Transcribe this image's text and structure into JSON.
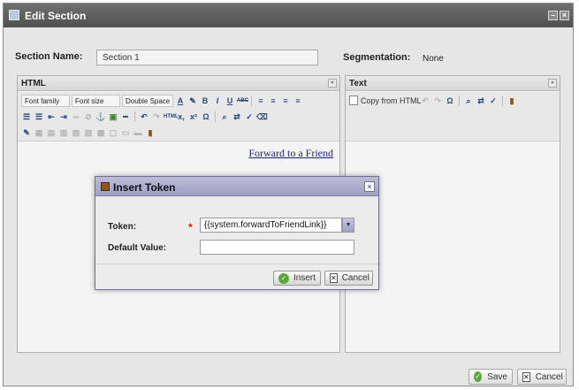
{
  "window": {
    "title": "Edit Section",
    "controls": [
      "minimize",
      "close"
    ]
  },
  "form": {
    "section_name_label": "Section Name:",
    "section_name_value": "Section 1",
    "segmentation_label": "Segmentation:",
    "segmentation_value": "None"
  },
  "html_pane": {
    "title": "HTML",
    "collapse_glyph": "«",
    "toolbar": {
      "font_family": "Font family",
      "font_size": "Font size",
      "spacing": "Double Space"
    },
    "content_link": "Forward to a Friend"
  },
  "text_pane": {
    "title": "Text",
    "collapse_glyph": "»",
    "copy_from_html": "Copy from HTML"
  },
  "dialog": {
    "title": "Insert Token",
    "token_label": "Token:",
    "required_mark": "*",
    "token_value": "{{system.forwardToFriendLink}}",
    "default_value_label": "Default Value:",
    "default_value": "",
    "insert_label": "Insert",
    "cancel_label": "Cancel",
    "close_glyph": "×"
  },
  "footer": {
    "save_label": "Save",
    "cancel_label": "Cancel"
  },
  "colors": {
    "title_bar": "#5f5f5f",
    "dialog_title": "#b0b0d0",
    "link": "#1a1aa6",
    "required": "#e01010",
    "ok_green": "#5aa83a"
  },
  "icons": [
    "window-icon",
    "token-icon",
    "check-icon",
    "cancel-x-icon",
    "copy-icon",
    "dropdown-arrow-icon"
  ]
}
